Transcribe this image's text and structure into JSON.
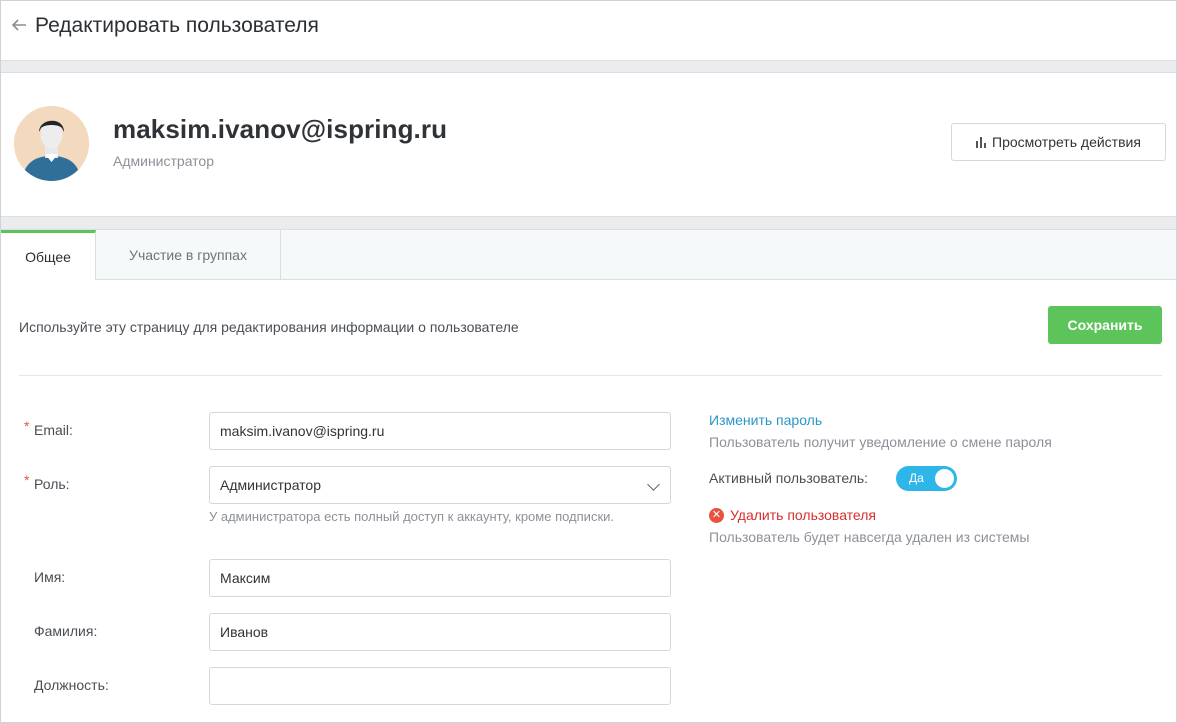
{
  "header": {
    "title": "Редактировать пользователя",
    "back_icon": "arrow-left-icon"
  },
  "profile": {
    "email": "maksim.ivanov@ispring.ru",
    "role": "Администратор",
    "view_actions_label": "Просмотреть действия",
    "view_actions_icon": "bar-chart-icon"
  },
  "tabs": [
    {
      "label": "Общее",
      "active": true
    },
    {
      "label": "Участие в группах",
      "active": false
    }
  ],
  "form": {
    "intro": "Используйте эту страницу для редактирования информации о пользователе",
    "save_label": "Сохранить",
    "fields": {
      "email": {
        "label": "Email:",
        "value": "maksim.ivanov@ispring.ru",
        "required": true
      },
      "role": {
        "label": "Роль:",
        "value": "Администратор",
        "required": true,
        "hint": "У администратора есть полный доступ к аккаунту, кроме подписки."
      },
      "first_name": {
        "label": "Имя:",
        "value": "Максим"
      },
      "last_name": {
        "label": "Фамилия:",
        "value": "Иванов"
      },
      "position": {
        "label": "Должность:",
        "value": ""
      }
    },
    "required_mark": "*"
  },
  "side": {
    "change_password_label": "Изменить пароль",
    "change_password_note": "Пользователь получит уведомление о смене пароля",
    "active_label": "Активный пользователь:",
    "active_toggle_text": "Да",
    "active": true,
    "delete_label": "Удалить пользователя",
    "delete_note": "Пользователь будет навсегда удален из системы",
    "delete_icon_glyph": "✕"
  },
  "colors": {
    "accent_green": "#5cc45a",
    "link_blue": "#2a96c8",
    "toggle_blue": "#2eb6e8",
    "danger_red": "#d62f2f"
  }
}
